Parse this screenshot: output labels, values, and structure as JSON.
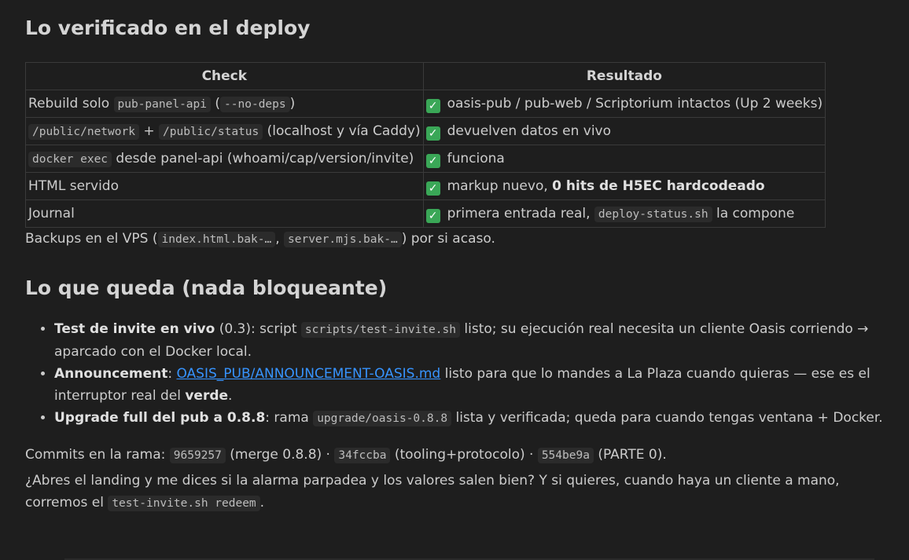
{
  "section1": {
    "heading": "Lo verificado en el deploy",
    "table": {
      "headers": [
        "Check",
        "Resultado"
      ],
      "rows": [
        {
          "check": {
            "pre": "Rebuild solo ",
            "code1": "pub-panel-api",
            "mid": " (",
            "code2": "--no-deps",
            "post": ")"
          },
          "result": {
            "text": "oasis-pub / pub-web / Scriptorium intactos (Up 2 weeks)"
          }
        },
        {
          "check": {
            "code1": "/public/network",
            "mid": " + ",
            "code2": "/public/status",
            "post": " (localhost y vía Caddy)"
          },
          "result": {
            "text": "devuelven datos en vivo"
          }
        },
        {
          "check": {
            "code1": "docker exec",
            "post": " desde panel-api (whoami/cap/version/invite)"
          },
          "result": {
            "text": "funciona"
          }
        },
        {
          "check": {
            "text": "HTML servido"
          },
          "result": {
            "pre": "markup nuevo, ",
            "bold": "0 hits de H5EC hardcodeado"
          }
        },
        {
          "check": {
            "text": "Journal"
          },
          "result": {
            "pre": "primera entrada real, ",
            "code": "deploy-status.sh",
            "post": " la compone"
          }
        }
      ]
    },
    "backups": {
      "pre": "Backups en el VPS (",
      "code1": "index.html.bak-…",
      "mid": ", ",
      "code2": "server.mjs.bak-…",
      "post": ") por si acaso."
    }
  },
  "section2": {
    "heading": "Lo que queda (nada bloqueante)",
    "items": [
      {
        "bold": "Test de invite en vivo",
        "t1": " (0.3): script ",
        "code": "scripts/test-invite.sh",
        "t2": " listo; su ejecución real necesita un cliente Oasis corriendo → aparcado con el Docker local."
      },
      {
        "bold": "Announcement",
        "t1": ": ",
        "link": "OASIS_PUB/ANNOUNCEMENT-OASIS.md",
        "t2": " listo para que lo mandes a La Plaza cuando quieras — ese es el interruptor real del ",
        "bold2": "verde",
        "t3": "."
      },
      {
        "bold": "Upgrade full del pub a 0.8.8",
        "t1": ": rama ",
        "code": "upgrade/oasis-0.8.8",
        "t2": " lista y verificada; queda para cuando tengas ventana + Docker."
      }
    ]
  },
  "commits": {
    "pre": "Commits en la rama: ",
    "c1": "9659257",
    "t1": " (merge 0.8.8) · ",
    "c2": "34fccba",
    "t2": " (tooling+protocolo) · ",
    "c3": "554be9a",
    "t3": " (PARTE 0)."
  },
  "closing": {
    "text": "¿Abres el landing y me dices si la alarma parpadea y los valores salen bien? Y si quieres, cuando haya un cliente a mano, corremos el ",
    "code": "test-invite.sh redeem",
    "post": "."
  },
  "icons": {
    "check": "check-mark-button-icon",
    "check_color": "#3aa757"
  }
}
